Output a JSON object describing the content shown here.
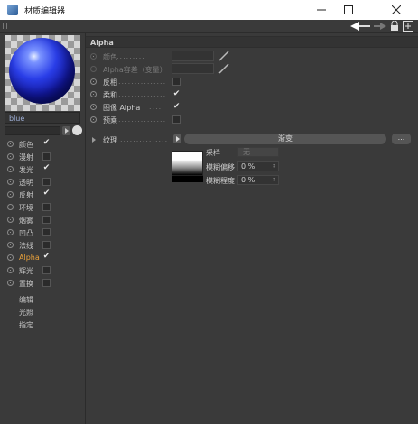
{
  "window": {
    "title": "材质编辑器"
  },
  "material": {
    "name": "blue"
  },
  "channels": [
    {
      "label": "颜色",
      "checked": true
    },
    {
      "label": "漫射",
      "checked": false
    },
    {
      "label": "发光",
      "checked": true
    },
    {
      "label": "透明",
      "checked": false
    },
    {
      "label": "反射",
      "checked": true
    },
    {
      "label": "环境",
      "checked": false
    },
    {
      "label": "烟雾",
      "checked": false
    },
    {
      "label": "凹凸",
      "checked": false
    },
    {
      "label": "法线",
      "checked": false
    },
    {
      "label": "Alpha",
      "checked": true,
      "active": true
    },
    {
      "label": "辉光",
      "checked": false
    },
    {
      "label": "置换",
      "checked": false
    }
  ],
  "extra_items": [
    "编辑",
    "光照",
    "指定"
  ],
  "panel": {
    "section_title": "Alpha",
    "props": [
      {
        "label": "颜色",
        "dim": true
      },
      {
        "label": "Alpha容差（变量）",
        "dim": true
      },
      {
        "label": "反相",
        "checked": false
      },
      {
        "label": "柔和",
        "checked": true
      },
      {
        "label": "图像 Alpha",
        "checked": true
      },
      {
        "label": "预乘",
        "checked": false
      }
    ],
    "texture": {
      "label": "纹理",
      "shader": "渐变",
      "more": "...",
      "sampling_label": "采样",
      "sampling_value": "无",
      "blur_offset_label": "模糊偏移",
      "blur_offset_value": "0 %",
      "blur_scale_label": "模糊程度",
      "blur_scale_value": "0 %"
    }
  },
  "colors": {
    "accent": "#e9a13a",
    "sphere": "#2a3ee8",
    "background": "#3a3a3a"
  }
}
